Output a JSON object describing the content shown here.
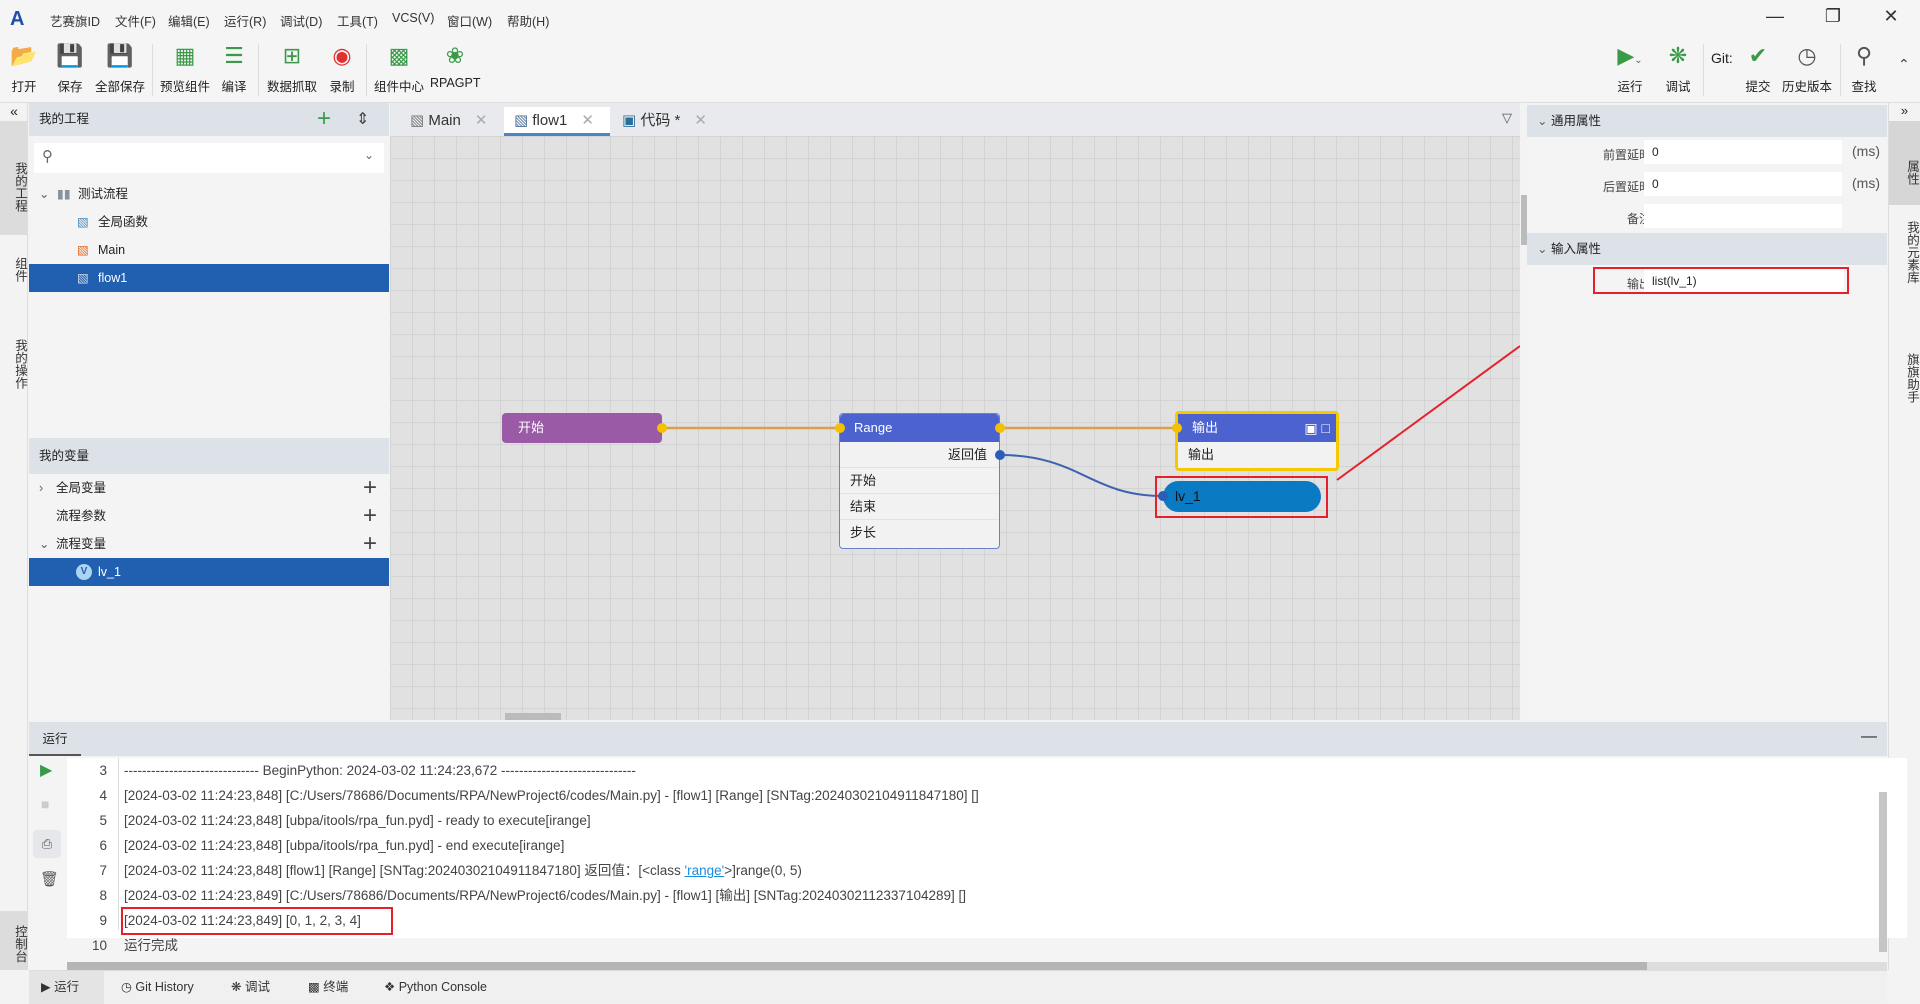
{
  "app": {
    "logo": "A",
    "menu": [
      "艺赛旗ID",
      "文件(F)",
      "编辑(E)",
      "运行(R)",
      "调试(D)",
      "工具(T)",
      "VCS(V)",
      "窗口(W)",
      "帮助(H)"
    ]
  },
  "toolbar": {
    "left": [
      {
        "label": "打开",
        "icon": "folder-open-icon"
      },
      {
        "label": "保存",
        "icon": "save-icon"
      },
      {
        "label": "全部保存",
        "icon": "save-all-icon"
      },
      {
        "label": "预览组件",
        "icon": "preview-components-icon"
      },
      {
        "label": "编译",
        "icon": "compile-icon"
      },
      {
        "label": "数据抓取",
        "icon": "data-capture-icon"
      },
      {
        "label": "录制",
        "icon": "record-icon"
      },
      {
        "label": "组件中心",
        "icon": "component-center-icon"
      },
      {
        "label": "RPAGPT",
        "icon": "rpagpt-icon"
      }
    ],
    "right": {
      "run": "运行",
      "debug": "调试",
      "git": "Git:",
      "commit": "提交",
      "history": "历史版本",
      "search": "查找"
    }
  },
  "left_strip": [
    "我的工程",
    "组件",
    "我的操作"
  ],
  "project": {
    "title": "我的工程",
    "tree": {
      "folder": "测试流程",
      "items": [
        "全局函数",
        "Main",
        "flow1"
      ],
      "selected": "flow1"
    }
  },
  "variables": {
    "title": "我的变量",
    "groups": [
      "全局变量",
      "流程参数",
      "流程变量"
    ],
    "flow_var": "lv_1"
  },
  "tabs": [
    {
      "label": "Main"
    },
    {
      "label": "flow1",
      "active": true
    },
    {
      "label": "代码 *"
    }
  ],
  "canvas": {
    "start": "开始",
    "range": {
      "title": "Range",
      "return": "返回值",
      "params": [
        "开始",
        "结束",
        "步长"
      ]
    },
    "output": {
      "title": "输出",
      "param": "输出"
    },
    "var": "lv_1"
  },
  "properties": {
    "general": "通用属性",
    "pre_delay_label": "前置延时",
    "pre_delay": "0",
    "post_delay_label": "后置延时",
    "post_delay": "0",
    "unit": "(ms)",
    "note_label": "备注",
    "input": "输入属性",
    "output_label": "输出",
    "output_value": "list(lv_1)"
  },
  "right_strip": [
    "属性",
    "我的元素库",
    "旗旗助手"
  ],
  "console": {
    "title": "运行",
    "lines": [
      {
        "n": "3",
        "t": "------------------------------ BeginPython: 2024-03-02 11:24:23,672 ------------------------------"
      },
      {
        "n": "4",
        "t": "[2024-03-02 11:24:23,848] [C:/Users/78686/Documents/RPA/NewProject6/codes/Main.py] - [flow1] [Range] [SNTag:20240302104911847180] []"
      },
      {
        "n": "5",
        "t": "[2024-03-02 11:24:23,848] [ubpa/itools/rpa_fun.pyd] - ready to execute[irange]"
      },
      {
        "n": "6",
        "t": "[2024-03-02 11:24:23,848] [ubpa/itools/rpa_fun.pyd] - end execute[irange]"
      },
      {
        "n": "7",
        "t": "[2024-03-02 11:24:23,848] [flow1] [Range] [SNTag:20240302104911847180]  返回值：[<class ",
        "link": "'range'",
        "t2": ">]range(0, 5)"
      },
      {
        "n": "8",
        "t": "[2024-03-02 11:24:23,849] [C:/Users/78686/Documents/RPA/NewProject6/codes/Main.py] - [flow1] [输出] [SNTag:20240302112337104289] []"
      },
      {
        "n": "9",
        "t": "[2024-03-02 11:24:23,849] [0, 1, 2, 3, 4]"
      },
      {
        "n": "10",
        "t": "运行完成"
      }
    ]
  },
  "left_strip_bottom": "控制台",
  "bottom_tabs": [
    "运行",
    "Git History",
    "调试",
    "终端",
    "Python Console"
  ],
  "colors": {
    "accent": "#215fb0",
    "start_node": "#9a5aa6",
    "node_head": "#4c63cf",
    "var_node": "#0a7bc2",
    "highlight": "#e5202a",
    "selected_node_border": "#f5c800"
  }
}
